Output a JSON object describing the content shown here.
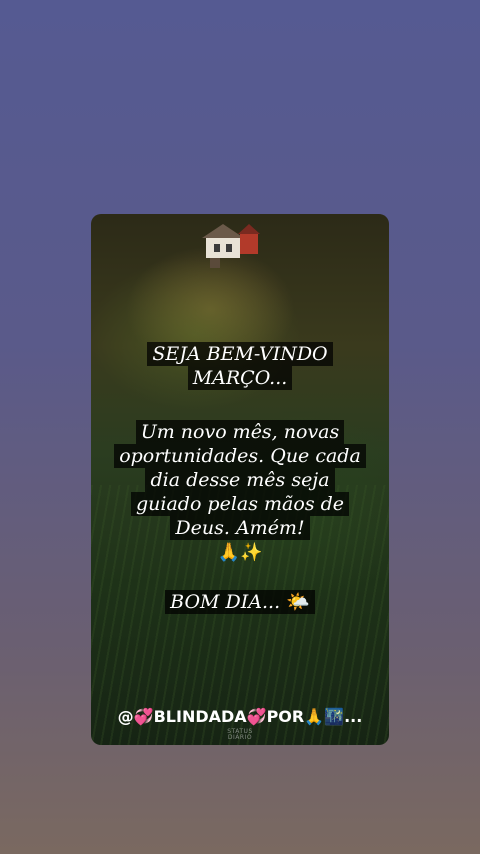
{
  "post": {
    "greeting_line1": "SEJA BEM-VINDO",
    "greeting_line2": "MARÇO...",
    "message_line1": "Um novo mês, novas",
    "message_line2": "oportunidades. Que cada",
    "message_line3": "dia desse mês seja",
    "message_line4": "guiado pelas mãos de",
    "message_line5": "Deus. Amém!",
    "emojis": "🙏✨",
    "bom_dia": "BOM DIA...",
    "bom_dia_emoji": "🌤️",
    "handle": "@💞BLINDADA💞POR🙏🌃..."
  },
  "watermark": {
    "line1": "STATUS",
    "line2": "DIÁRIO"
  },
  "colors": {
    "background_top": "#555a92",
    "background_bottom": "#7a6960",
    "text": "#ffffff",
    "highlight": "#000000"
  }
}
